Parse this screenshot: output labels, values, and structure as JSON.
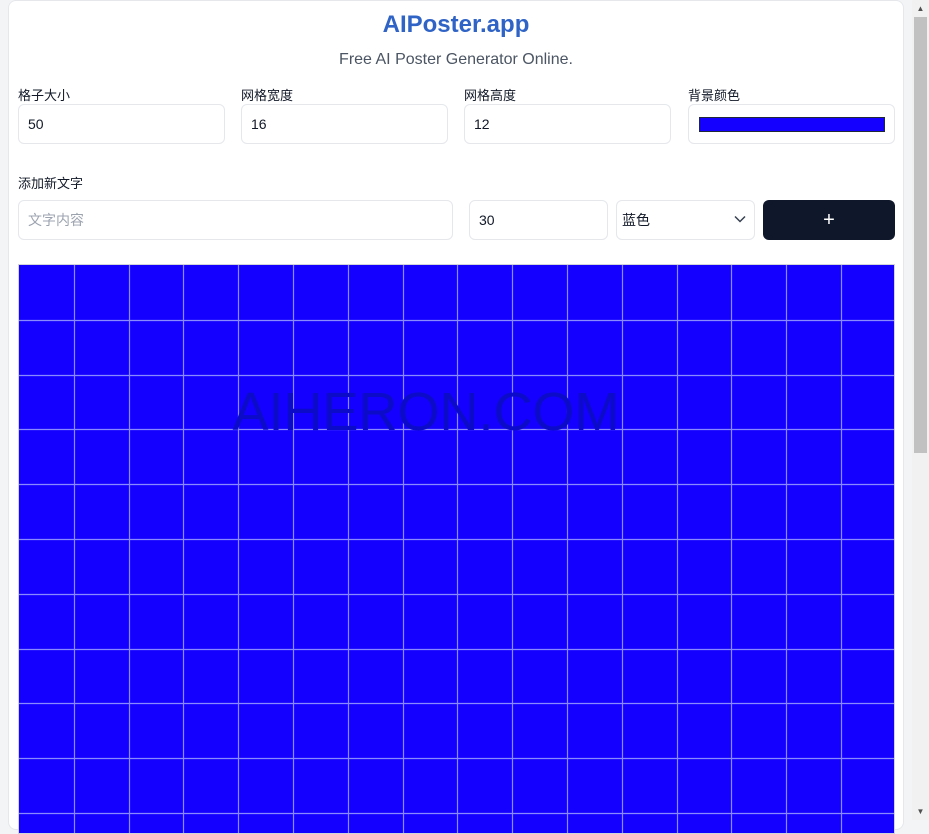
{
  "header": {
    "brand": "AIPoster.app",
    "subtitle": "Free AI Poster Generator Online."
  },
  "settings": {
    "cell_size": {
      "label": "格子大小",
      "value": "50"
    },
    "grid_width": {
      "label": "网格宽度",
      "value": "16"
    },
    "grid_height": {
      "label": "网格高度",
      "value": "12"
    },
    "background_color": {
      "label": "背景颜色",
      "value": "#1400ff"
    }
  },
  "add_text": {
    "label": "添加新文字",
    "content_placeholder": "文字内容",
    "content_value": "",
    "font_size_value": "30",
    "color_selected": "蓝色",
    "add_button_label": "+"
  },
  "canvas": {
    "columns": 16,
    "rows": 12,
    "watermark": "AIHERON.COM",
    "grid_line_color": "#8a8aff",
    "watermark_color": "#0c0cc8"
  },
  "icons": {
    "select": "chevron-down-icon",
    "scroll_up": "triangle-up-icon",
    "scroll_down": "triangle-down-icon"
  }
}
